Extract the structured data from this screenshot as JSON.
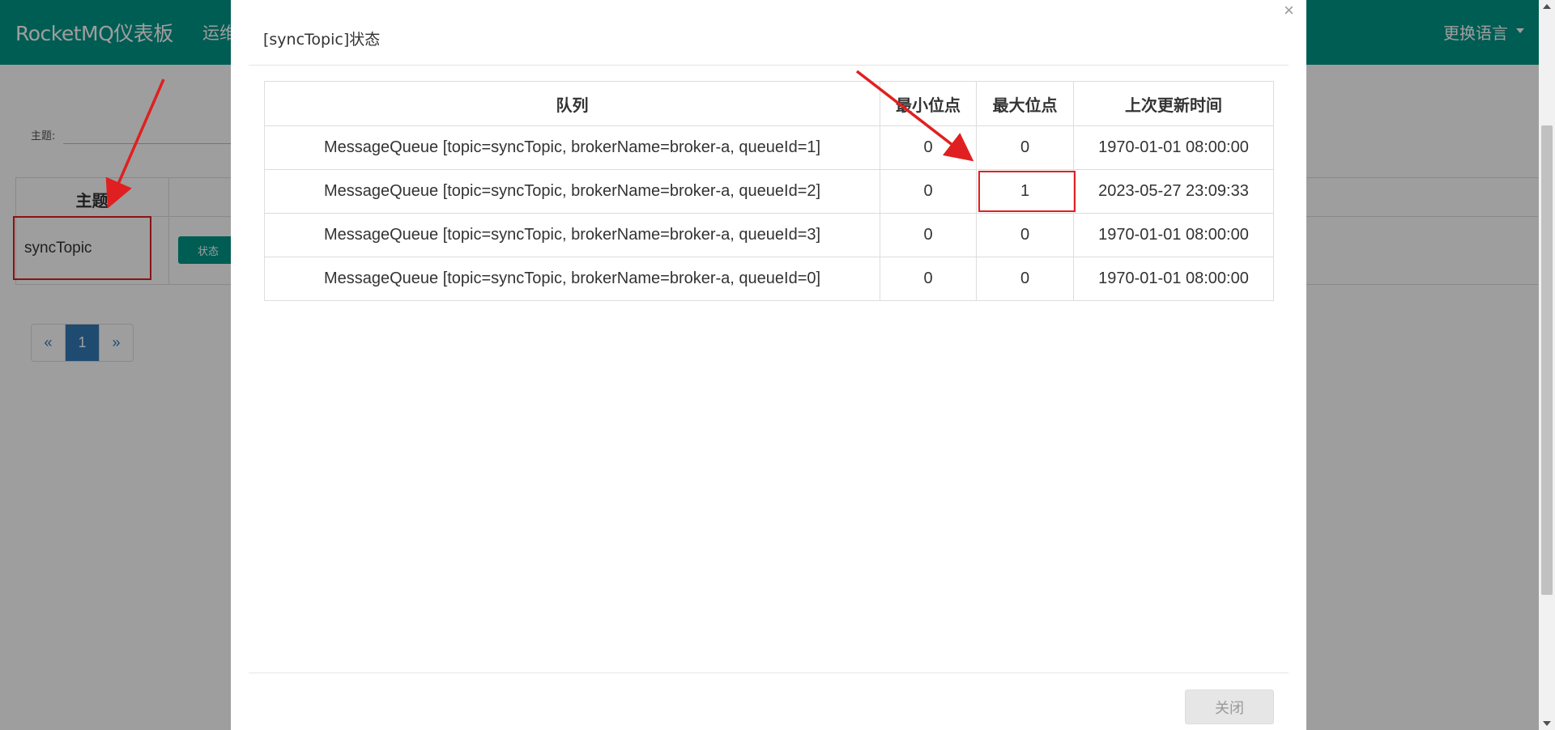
{
  "navbar": {
    "brand": "RocketMQ仪表板",
    "ops": "运维",
    "language": "更换语言"
  },
  "filter": {
    "label": "主题:"
  },
  "background_table": {
    "header": "主题",
    "topic": "syncTopic",
    "status_button": "状态"
  },
  "pagination": {
    "prev": "«",
    "current": "1",
    "next": "»"
  },
  "modal": {
    "title": "[syncTopic]状态",
    "close_icon": "×",
    "columns": [
      "队列",
      "最小位点",
      "最大位点",
      "上次更新时间"
    ],
    "rows": [
      {
        "queue": "MessageQueue [topic=syncTopic, brokerName=broker-a, queueId=1]",
        "min": "0",
        "max": "0",
        "updated": "1970-01-01 08:00:00"
      },
      {
        "queue": "MessageQueue [topic=syncTopic, brokerName=broker-a, queueId=2]",
        "min": "0",
        "max": "1",
        "updated": "2023-05-27 23:09:33"
      },
      {
        "queue": "MessageQueue [topic=syncTopic, brokerName=broker-a, queueId=3]",
        "min": "0",
        "max": "0",
        "updated": "1970-01-01 08:00:00"
      },
      {
        "queue": "MessageQueue [topic=syncTopic, brokerName=broker-a, queueId=0]",
        "min": "0",
        "max": "0",
        "updated": "1970-01-01 08:00:00"
      }
    ],
    "close_button": "关闭"
  },
  "colors": {
    "primary": "#009688",
    "annotation": "#e02020",
    "link": "#337ab7"
  }
}
